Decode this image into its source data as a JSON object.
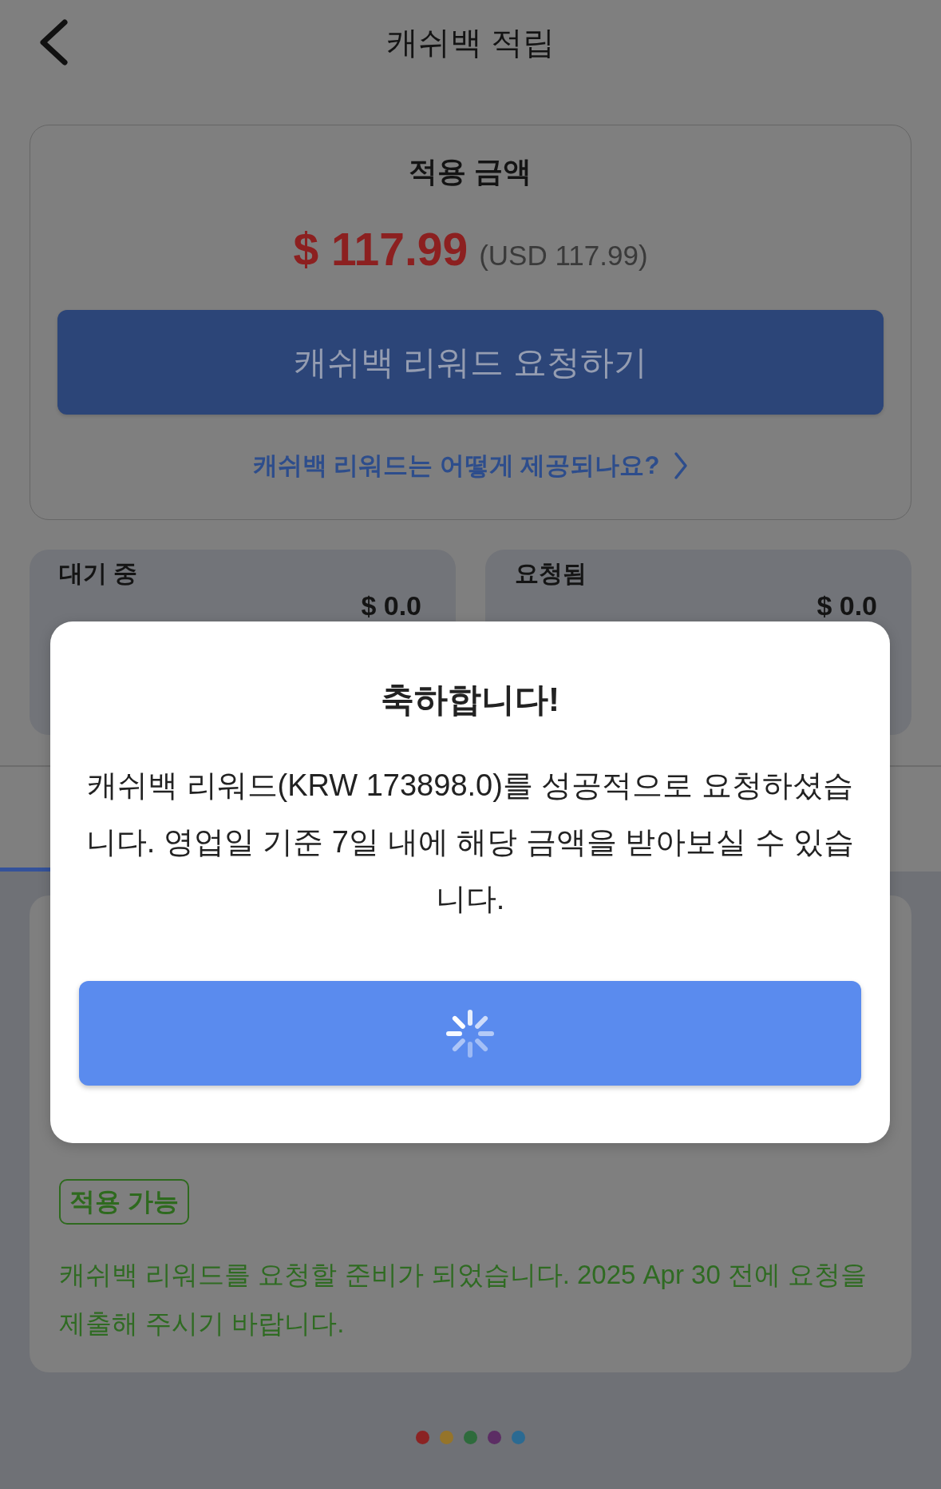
{
  "header": {
    "title": "캐쉬백 적립"
  },
  "summary_card": {
    "label": "적용 금액",
    "amount": "$ 117.99",
    "amount_note": "(USD 117.99)",
    "request_button": "캐쉬백 리워드 요청하기",
    "help_link": "캐쉬백 리워드는 어떻게 제공되나요?"
  },
  "status_cards": [
    {
      "title": "대기 중",
      "amount": "$ 0.0"
    },
    {
      "title": "요청됨",
      "amount": "$ 0.0"
    }
  ],
  "dialog": {
    "title": "축하합니다!",
    "message": "캐쉬백 리워드(KRW 173898.0)를 성공적으로 요청하셨습니다. 영업일 기준 7일 내에 해당 금액을 받아보실 수 있습니다.",
    "button": {
      "loading": true
    }
  },
  "notice_card": {
    "badge": "적용 가능",
    "message": "캐쉬백 리워드를 요청할 준비가 되었습니다. 2025 Apr 30 전에 요청을 제출해 주시기 바랍니다."
  },
  "loading_dots": [
    {
      "color": "#8b2323"
    },
    {
      "color": "#95742a"
    },
    {
      "color": "#2e6b3c"
    },
    {
      "color": "#5c2d64"
    },
    {
      "color": "#2b6a92"
    }
  ]
}
